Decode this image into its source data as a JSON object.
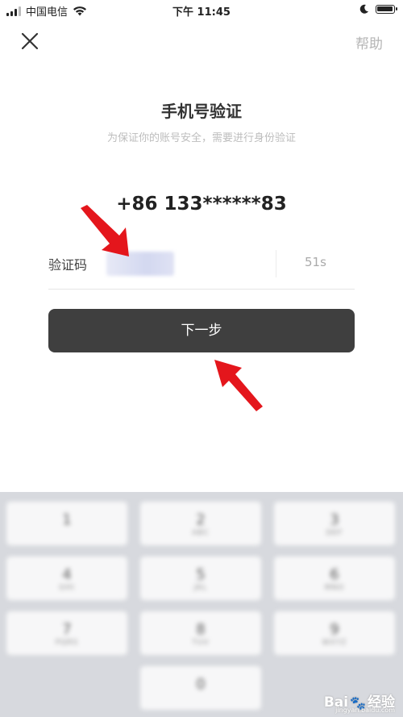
{
  "status_bar": {
    "carrier": "中国电信",
    "time": "下午 11:45"
  },
  "nav": {
    "help_label": "帮助"
  },
  "main": {
    "title": "手机号验证",
    "subtitle": "为保证你的账号安全，需要进行身份验证",
    "phone_number": "+86 133******83",
    "code_label": "验证码",
    "code_value": "",
    "countdown": "51s",
    "next_button_label": "下一步"
  },
  "keypad": {
    "keys": [
      {
        "digit": "1",
        "letters": ""
      },
      {
        "digit": "2",
        "letters": "ABC"
      },
      {
        "digit": "3",
        "letters": "DEF"
      },
      {
        "digit": "4",
        "letters": "GHI"
      },
      {
        "digit": "5",
        "letters": "JKL"
      },
      {
        "digit": "6",
        "letters": "MNO"
      },
      {
        "digit": "7",
        "letters": "PQRS"
      },
      {
        "digit": "8",
        "letters": "TUV"
      },
      {
        "digit": "9",
        "letters": "WXYZ"
      },
      {
        "digit": "0",
        "letters": ""
      }
    ]
  },
  "watermark": {
    "brand": "Bai",
    "paw": "🐾",
    "suffix": "经验",
    "url": "jingyan.baidu.com"
  },
  "colors": {
    "button_bg": "#3f3f3f",
    "arrow": "#e4161c",
    "help_text": "#b5b5b5"
  }
}
